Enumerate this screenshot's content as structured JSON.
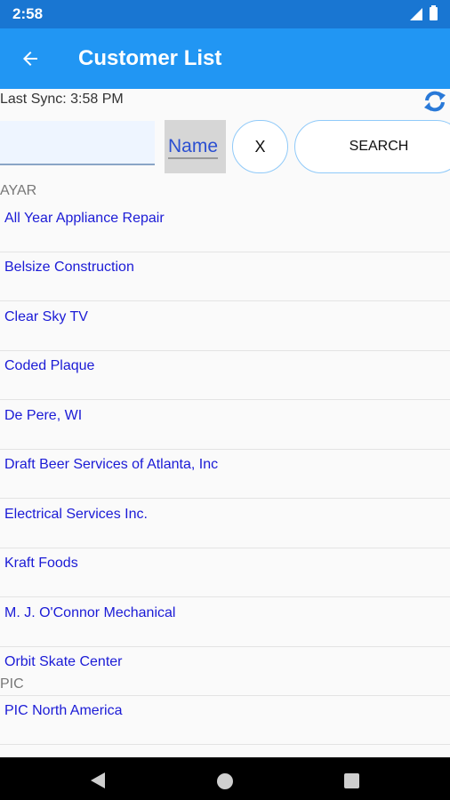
{
  "status_bar": {
    "time": "2:58"
  },
  "app_bar": {
    "title": "Customer List",
    "back_icon": "arrow-left-icon"
  },
  "sync": {
    "label": "Last Sync: 3:58 PM",
    "icon": "sync-icon"
  },
  "search": {
    "input_value": "",
    "field_label": "Name",
    "clear_label": "X",
    "search_label": "SEARCH"
  },
  "sections": [
    {
      "header": "AYAR",
      "items": [
        "All Year Appliance Repair",
        "Belsize Construction",
        "Clear Sky TV",
        "Coded Plaque",
        "De Pere, WI",
        "Draft Beer Services of Atlanta, Inc",
        "Electrical Services Inc.",
        "Kraft Foods",
        "M. J. O'Connor Mechanical",
        "Orbit Skate Center"
      ]
    },
    {
      "header": "PIC",
      "items": [
        "PIC North America"
      ]
    }
  ],
  "colors": {
    "primary": "#2196f3",
    "status_bar": "#1976d2",
    "item_text": "#1b1bd6"
  },
  "nav_bar": {
    "back_icon": "triangle-back-icon",
    "home_icon": "circle-home-icon",
    "recents_icon": "square-recents-icon"
  }
}
